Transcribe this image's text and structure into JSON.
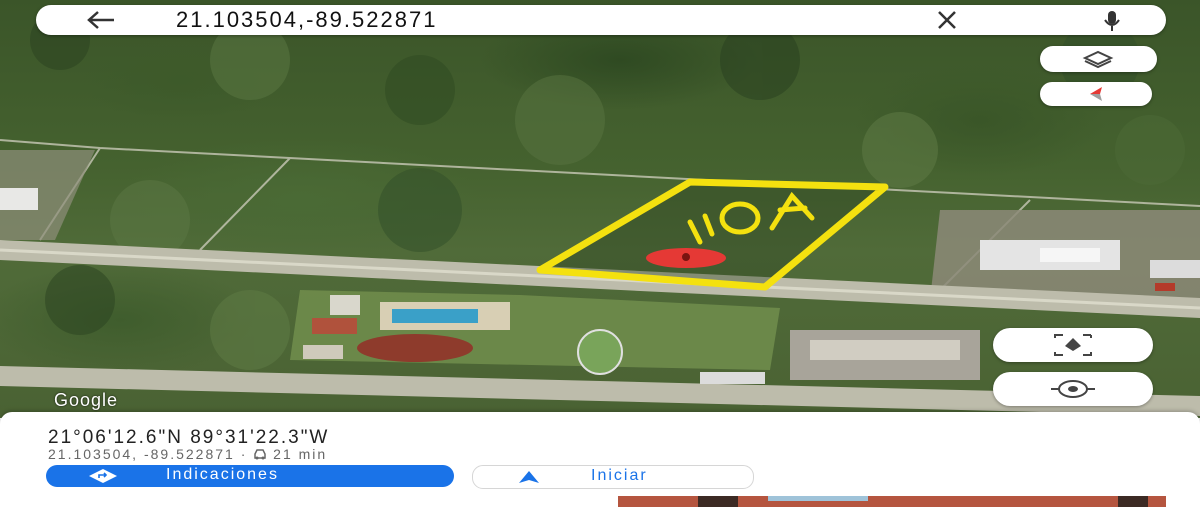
{
  "search": {
    "query": "21.103504,-89.522871"
  },
  "map": {
    "attribution": "Google",
    "annotation_text": "IO A",
    "annotation_color": "#f4e10f",
    "pin_color": "#e53935"
  },
  "place": {
    "dms": "21°06'12.6\"N 89°31'22.3\"W",
    "decimal": "21.103504, -89.522871",
    "separator": "·",
    "drive_time": "21 min"
  },
  "actions": {
    "directions_label": "Indicaciones",
    "start_label": "Iniciar"
  },
  "colors": {
    "accent": "#1a73e8"
  }
}
